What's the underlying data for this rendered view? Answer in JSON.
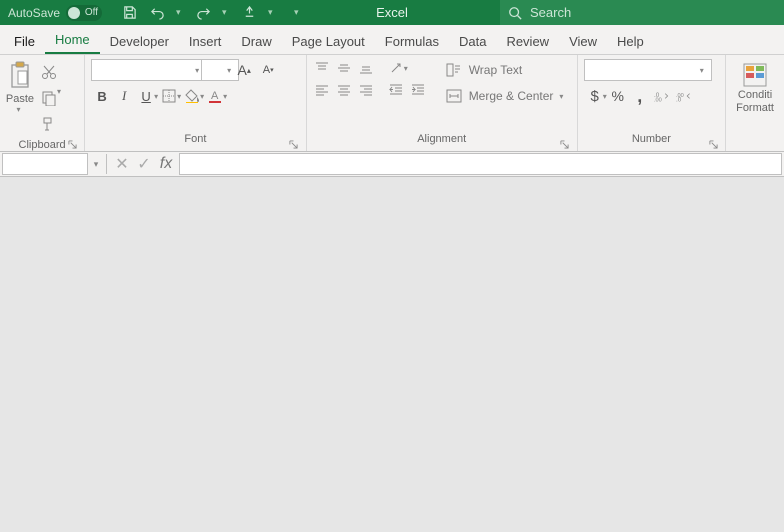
{
  "titlebar": {
    "autosave_label": "AutoSave",
    "autosave_state": "Off",
    "app_name": "Excel",
    "search_placeholder": "Search"
  },
  "tabs": {
    "file": "File",
    "home": "Home",
    "developer": "Developer",
    "insert": "Insert",
    "draw": "Draw",
    "page_layout": "Page Layout",
    "formulas": "Formulas",
    "data": "Data",
    "review": "Review",
    "view": "View",
    "help": "Help"
  },
  "ribbon": {
    "clipboard": {
      "label": "Clipboard",
      "paste": "Paste"
    },
    "font": {
      "label": "Font",
      "name_value": "",
      "size_value": "",
      "bold": "B",
      "italic": "I",
      "underline": "U"
    },
    "alignment": {
      "label": "Alignment",
      "wrap_text": "Wrap Text",
      "merge_center": "Merge & Center"
    },
    "number": {
      "label": "Number",
      "format_value": ""
    },
    "styles": {
      "conditional_line1": "Conditi",
      "conditional_line2": "Formatt"
    }
  },
  "formulabar": {
    "namebox_value": "",
    "formula_value": ""
  }
}
